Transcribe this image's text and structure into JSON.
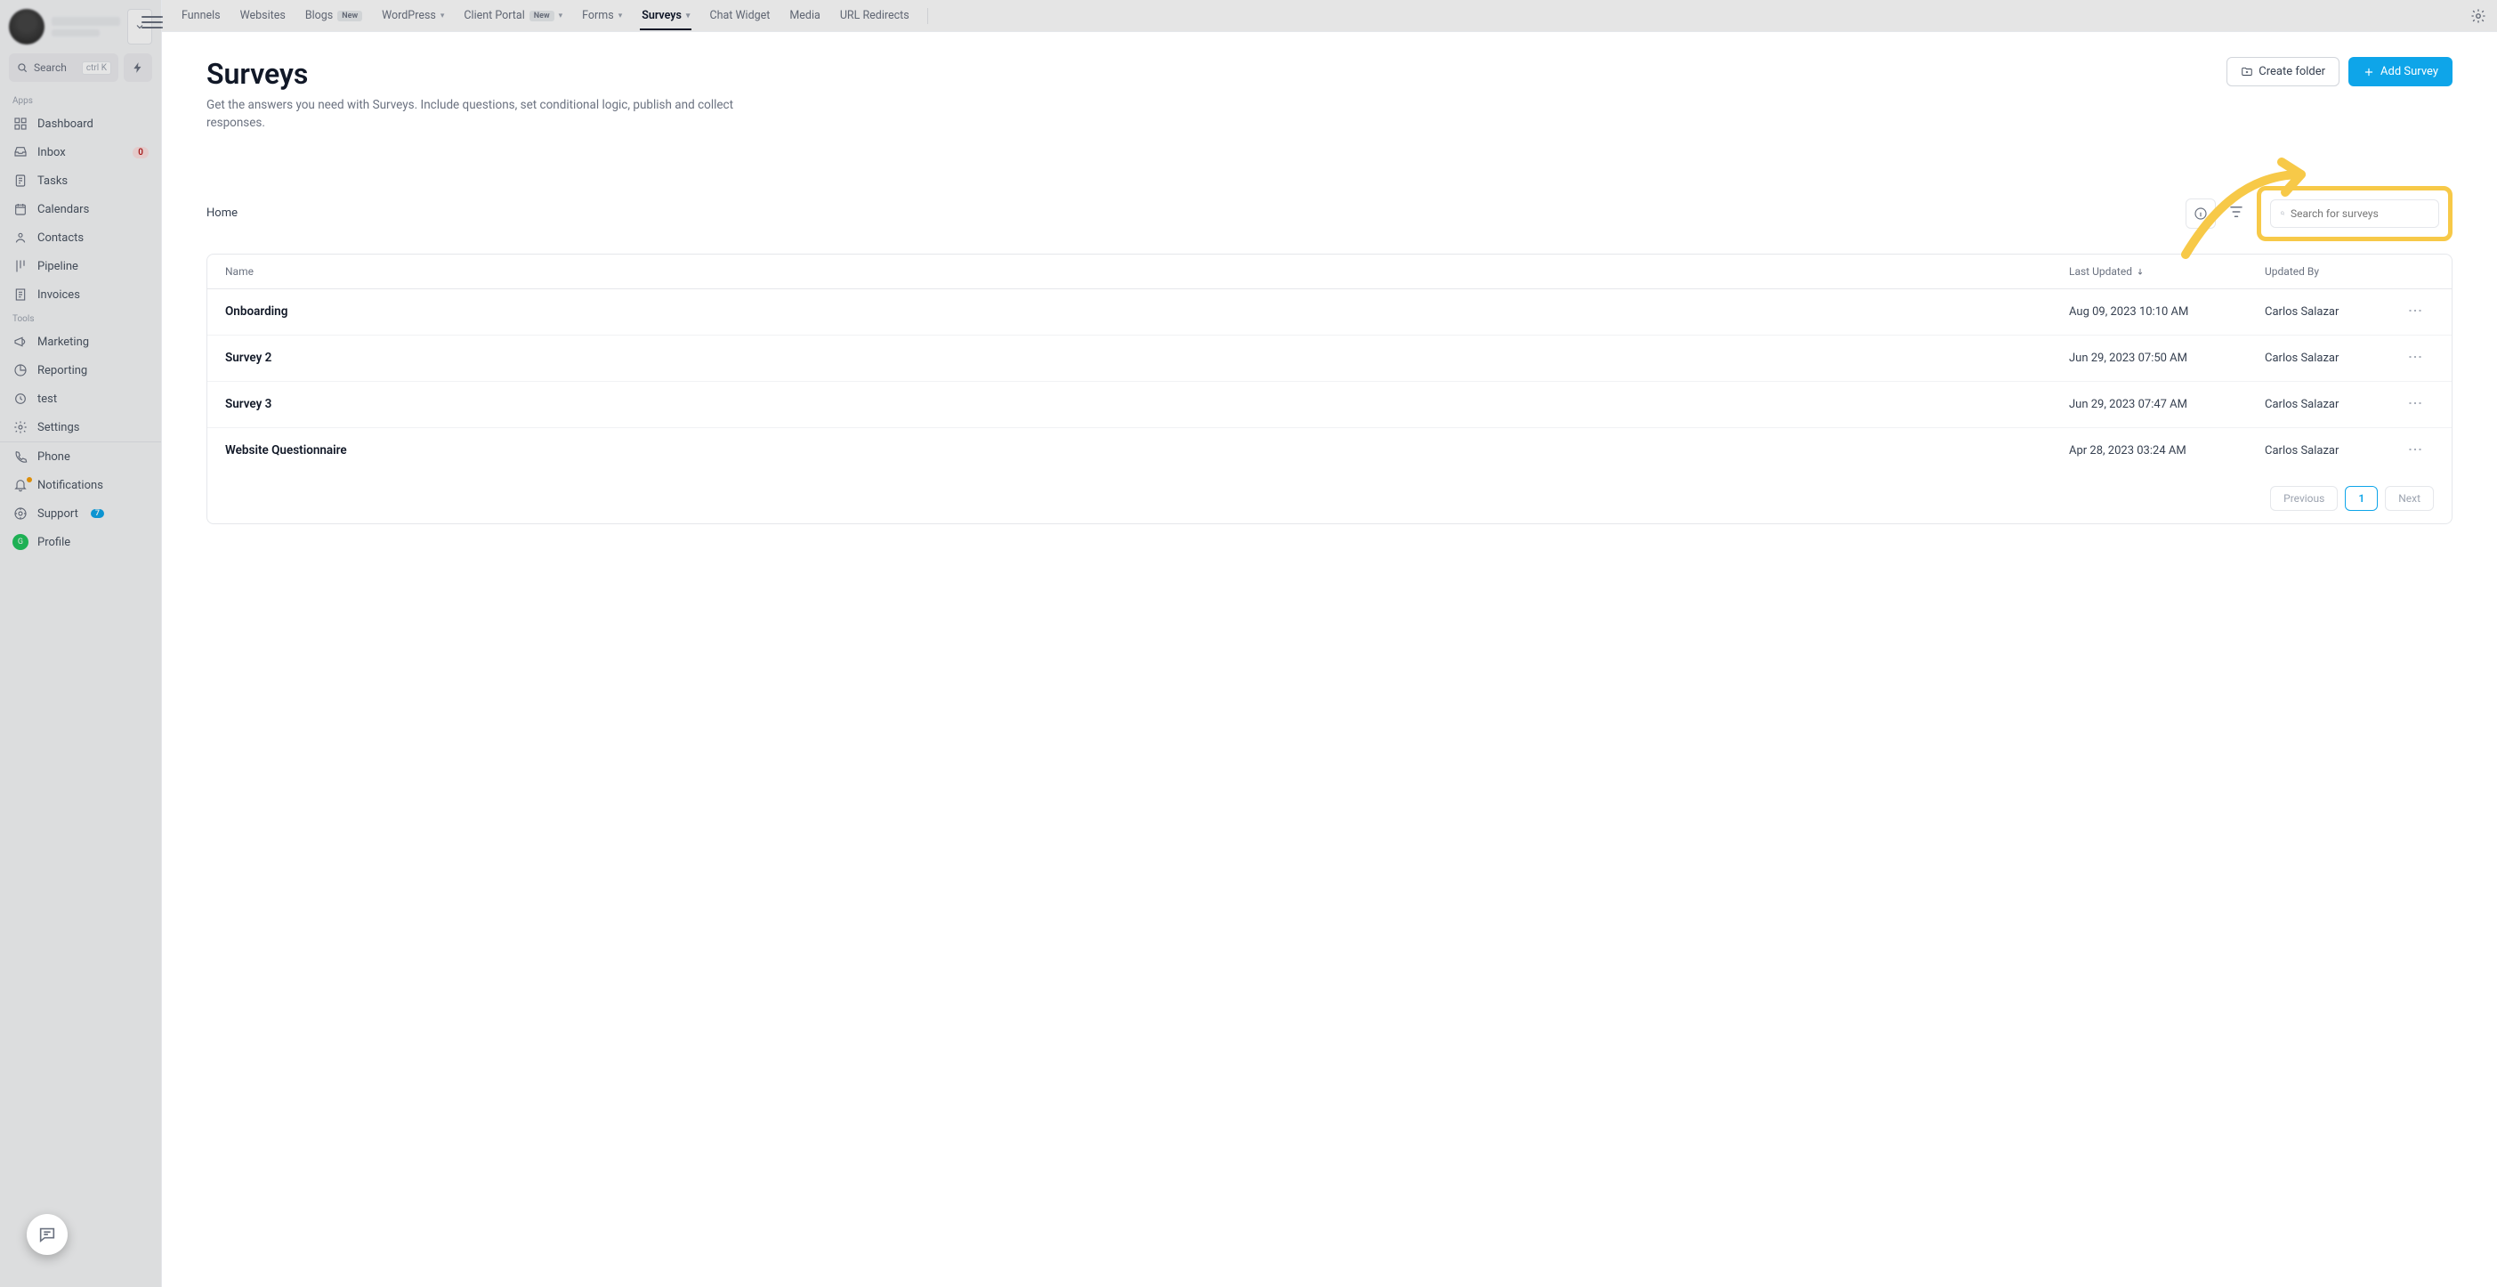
{
  "sidebar": {
    "search_label": "Search",
    "kbd": "ctrl K",
    "sections": [
      {
        "label": "Apps",
        "items": [
          {
            "icon": "dashboard",
            "label": "Dashboard"
          },
          {
            "icon": "inbox",
            "label": "Inbox",
            "badge": "0"
          },
          {
            "icon": "tasks",
            "label": "Tasks"
          },
          {
            "icon": "calendar",
            "label": "Calendars"
          },
          {
            "icon": "contacts",
            "label": "Contacts"
          },
          {
            "icon": "pipeline",
            "label": "Pipeline"
          },
          {
            "icon": "invoice",
            "label": "Invoices"
          }
        ]
      },
      {
        "label": "Tools",
        "items": [
          {
            "icon": "marketing",
            "label": "Marketing"
          },
          {
            "icon": "reporting",
            "label": "Reporting"
          },
          {
            "icon": "test",
            "label": "test"
          },
          {
            "icon": "settings",
            "label": "Settings"
          }
        ]
      }
    ],
    "bottom": [
      {
        "icon": "phone",
        "label": "Phone"
      },
      {
        "icon": "bell",
        "label": "Notifications",
        "dot": true
      },
      {
        "icon": "support",
        "label": "Support",
        "sup_badge": "7"
      },
      {
        "icon": "profile",
        "label": "Profile"
      }
    ]
  },
  "topnav": {
    "tabs": [
      {
        "label": "Funnels"
      },
      {
        "label": "Websites"
      },
      {
        "label": "Blogs",
        "new": "New"
      },
      {
        "label": "WordPress",
        "chev": true
      },
      {
        "label": "Client Portal",
        "new": "New",
        "chev": true
      },
      {
        "label": "Forms",
        "chev": true
      },
      {
        "label": "Surveys",
        "chev": true,
        "active": true
      },
      {
        "label": "Chat Widget"
      },
      {
        "label": "Media"
      },
      {
        "label": "URL Redirects"
      }
    ]
  },
  "page": {
    "title": "Surveys",
    "subtitle": "Get the answers you need with Surveys. Include questions, set conditional logic, publish and collect responses.",
    "create_folder": "Create folder",
    "add_survey": "Add Survey",
    "breadcrumb": "Home",
    "search_placeholder": "Search for surveys"
  },
  "table": {
    "headers": {
      "name": "Name",
      "updated": "Last Updated",
      "by": "Updated By"
    },
    "rows": [
      {
        "name": "Onboarding",
        "updated": "Aug 09, 2023 10:10 AM",
        "by": "Carlos Salazar"
      },
      {
        "name": "Survey 2",
        "updated": "Jun 29, 2023 07:50 AM",
        "by": "Carlos Salazar"
      },
      {
        "name": "Survey 3",
        "updated": "Jun 29, 2023 07:47 AM",
        "by": "Carlos Salazar"
      },
      {
        "name": "Website Questionnaire",
        "updated": "Apr 28, 2023 03:24 AM",
        "by": "Carlos Salazar"
      }
    ]
  },
  "pager": {
    "prev": "Previous",
    "page": "1",
    "next": "Next"
  }
}
